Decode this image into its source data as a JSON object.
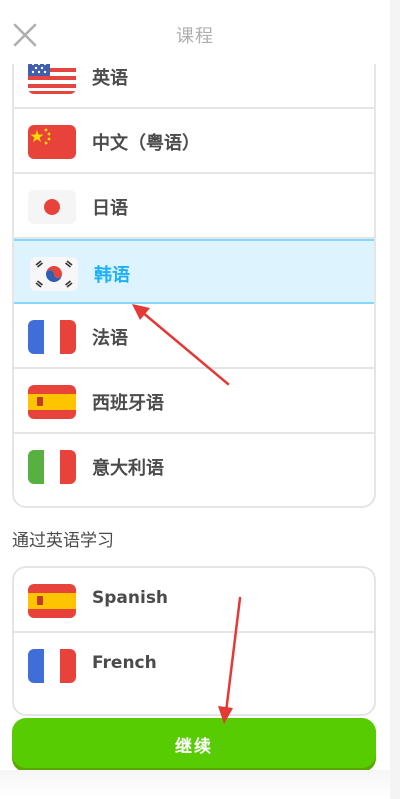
{
  "header": {
    "title": "课程",
    "close_icon": "close-icon"
  },
  "courses": [
    {
      "label": "英语",
      "flag": "us-flag-icon"
    },
    {
      "label": "中文（粤语）",
      "flag": "china-flag-icon"
    },
    {
      "label": "日语",
      "flag": "japan-flag-icon"
    },
    {
      "label": "韩语",
      "flag": "korea-flag-icon",
      "selected": true
    },
    {
      "label": "法语",
      "flag": "france-flag-icon"
    },
    {
      "label": "西班牙语",
      "flag": "spain-flag-icon"
    },
    {
      "label": "意大利语",
      "flag": "italy-flag-icon"
    }
  ],
  "section": {
    "title": "通过英语学习"
  },
  "english_courses": [
    {
      "label": "Spanish",
      "flag": "spain-flag-icon"
    },
    {
      "label": "French",
      "flag": "france-flag-icon"
    }
  ],
  "footer": {
    "continue_label": "继续"
  },
  "colors": {
    "selected_bg": "#ddf4ff",
    "selected_border": "#84d8ff",
    "selected_text": "#1cb0f6",
    "primary_button": "#58cc02",
    "annotation_arrow": "#e53935"
  }
}
